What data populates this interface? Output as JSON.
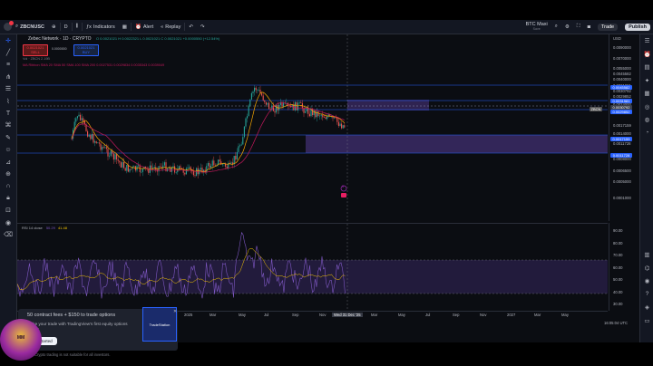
{
  "toolbar": {
    "symbol": "ZBCNUSC",
    "interval": "D",
    "indicators": "Indicators",
    "alert": "Alert",
    "replay": "Replay",
    "layout_name": "BTC Maxi",
    "layout_sub": "Save",
    "trade": "Trade",
    "publish": "Publish"
  },
  "chart": {
    "title": "Zebec Network · 1D · CRYPTO",
    "ohlc": "O 0.0021021 H 0.0022321 L 0.0021021 C 0.0021021 +0.0000550 (+12.54%)",
    "sell_price": "0.0021021",
    "sell_label": "SELL",
    "buy_price": "0.0021021",
    "buy_label": "BUY",
    "spread": "0.0000000",
    "vol_legend": "Vol · ZBCN  2.19B",
    "ma_legend": "MA Ribbon SMA 20 SMA 50 SMA 100 SMA 200   0.0027531   0.0029834   0.0035343   0.0039049",
    "currency": "USD",
    "price_ticks": [
      "0.0090000",
      "0.0070000",
      "0.0055000",
      "0.0045582",
      "0.0040000",
      "0.0031981",
      "0.0030792",
      "0.0029852",
      "0.0024000",
      "0.0017159",
      "0.0014000",
      "0.0011728",
      "0.0008000",
      "0.0006500",
      "0.0005000",
      "0.0001000"
    ],
    "tags": {
      "level_a": "0.0045582",
      "level_b": "0.0031981",
      "current": "0.0030792",
      "level_c": "0.0029852",
      "level_d": "0.0017159",
      "level_e": "0.0011728",
      "current_symbol": "ZBCN"
    },
    "time_ticks": [
      "2025",
      "Mar",
      "May",
      "Jul",
      "Sep",
      "Nov",
      "Mar",
      "May",
      "Jul",
      "Sep",
      "Nov",
      "2027",
      "Mar",
      "May"
    ],
    "crosshair_date": "Wed 31 Dec '25",
    "clock": "16:05:04 UTC",
    "annotation": "3"
  },
  "rsi": {
    "legend": "RSI 14 close",
    "value_a": "50.29",
    "value_b": "41.48",
    "ticks": [
      "90.00",
      "80.00",
      "70.00",
      "60.00",
      "50.00",
      "40.00",
      "30.00"
    ]
  },
  "promo": {
    "headline": "50 contract fees + $150 to trade options",
    "body": "Make your trade with TradingView's first equity options broker.",
    "cta": "Get started",
    "thumb_label": "TradeStation"
  },
  "footer": {
    "warning": "Crypto trading is not suitable for all investors."
  },
  "avatar": {
    "label": "MM"
  },
  "colors": {
    "up": "#26a69a",
    "down": "#ef5350",
    "ma_fast": "#f7a600",
    "ma_slow": "#c2185b",
    "rsi_line": "#7e57c2",
    "zone": "#5b3fa0",
    "level_line": "#2962ff"
  }
}
